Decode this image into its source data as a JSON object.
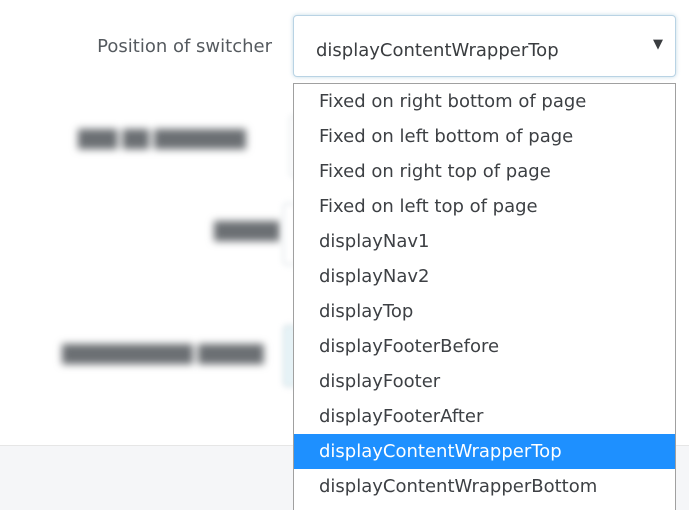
{
  "field": {
    "label": "Position of switcher",
    "selected_value": "displayContentWrapperTop",
    "caret_icon": "▼"
  },
  "dropdown": {
    "selected_index": 10,
    "options": [
      "Fixed on right bottom of page",
      "Fixed on left bottom of page",
      "Fixed on right top of page",
      "Fixed on left top of page",
      "displayNav1",
      "displayNav2",
      "displayTop",
      "displayFooterBefore",
      "displayFooter",
      "displayFooterAfter",
      "displayContentWrapperTop",
      "displayContentWrapperBottom"
    ]
  },
  "colors": {
    "selected_bg": "#1e90ff",
    "selected_text": "#ffffff"
  }
}
